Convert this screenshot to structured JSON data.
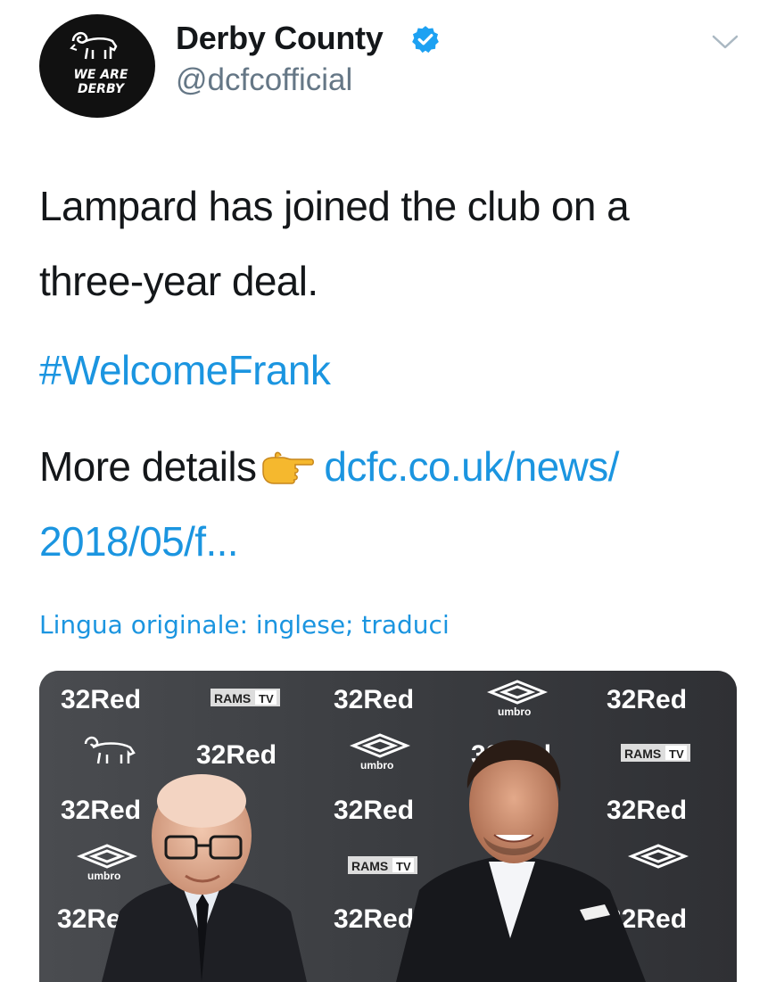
{
  "author": {
    "name": "Derby County",
    "handle": "@dcfcofficial",
    "avatar_text": "WE ARE DERBY",
    "verified": true
  },
  "tweet": {
    "line1": "Lampard has joined the club on a",
    "line2": "three-year deal.",
    "hashtag": "#WelcomeFrank",
    "details_prefix": "More details",
    "link_line1": "dcfc.co.uk/news/",
    "link_line2": "2018/05/f...",
    "translate_text": "Lingua originale: inglese; traduci"
  },
  "media": {
    "backdrop_labels": {
      "sponsor": "32Red",
      "tv": "RAMS",
      "tv_suffix": "TV",
      "kit": "umbro"
    }
  },
  "colors": {
    "link": "#1b95e0",
    "text": "#14171a",
    "secondary": "#657786",
    "verified": "#1da1f2"
  },
  "icons": [
    "ram-logo-icon",
    "verified-badge-icon",
    "chevron-down-icon",
    "pointing-hand-icon",
    "umbro-diamond-icon"
  ]
}
